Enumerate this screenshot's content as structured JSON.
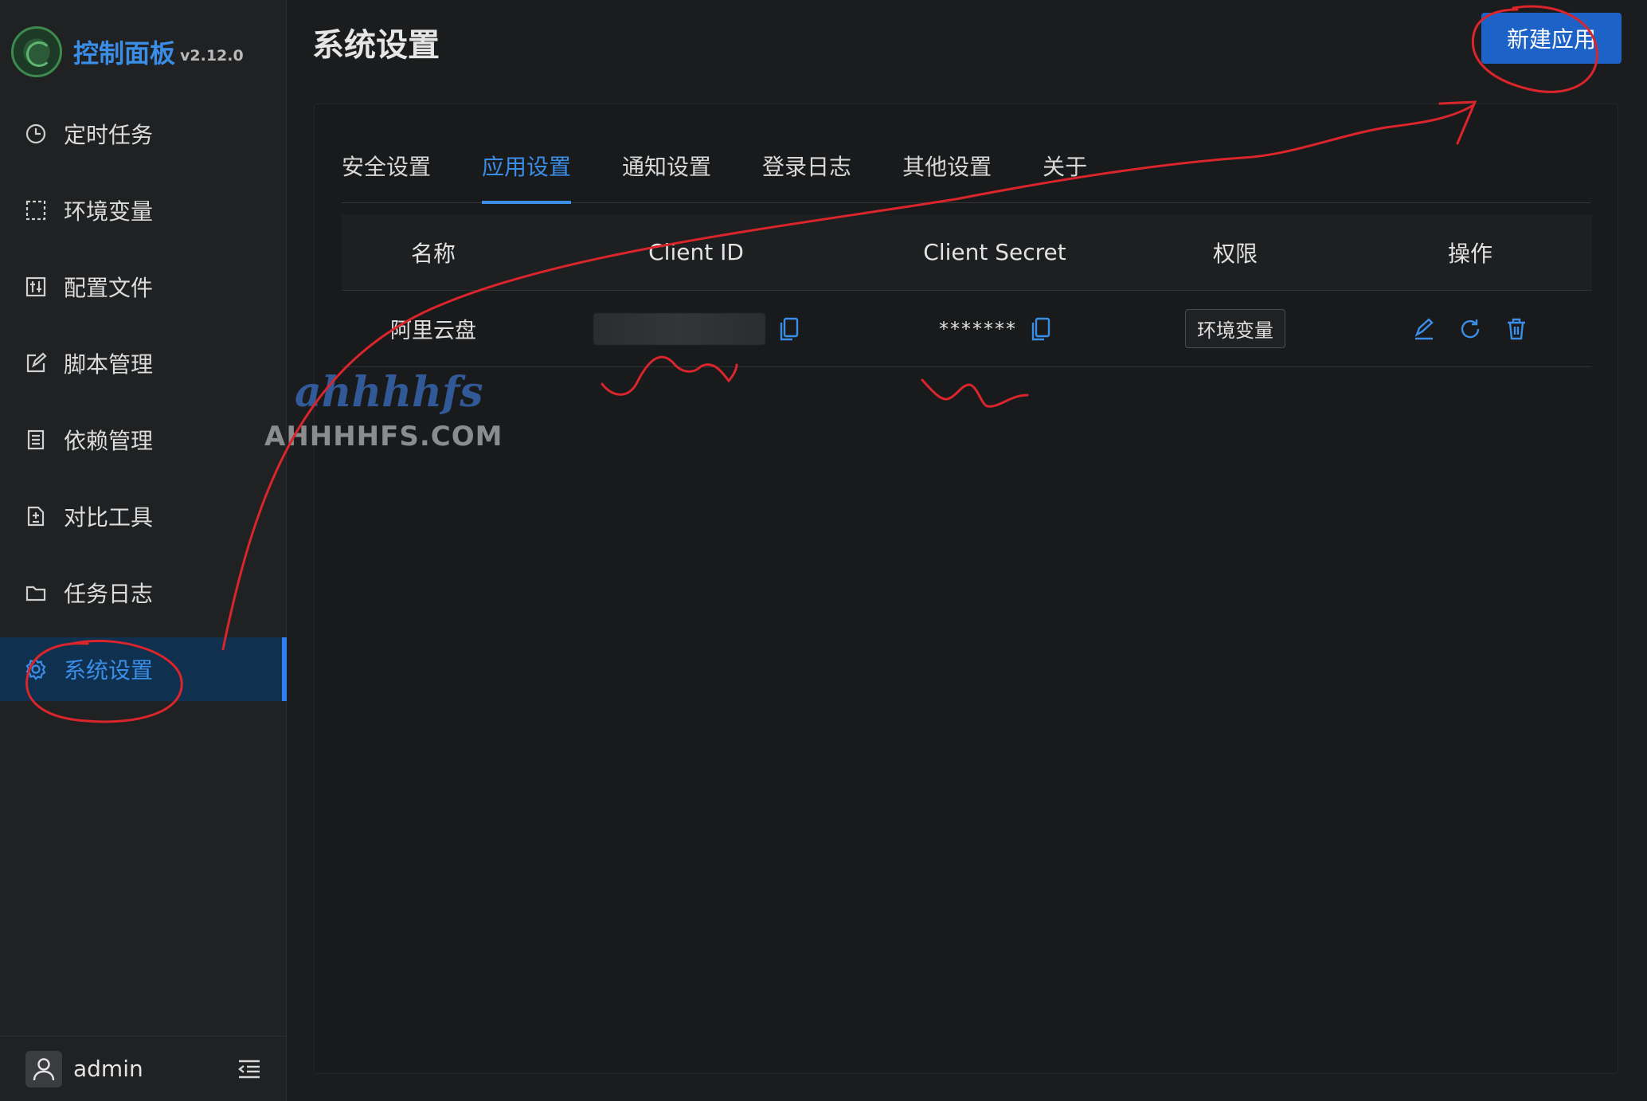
{
  "brand": {
    "title": "控制面板",
    "version": "v2.12.0"
  },
  "sidebar": {
    "items": [
      {
        "label": "定时任务",
        "icon": "clock-icon"
      },
      {
        "label": "环境变量",
        "icon": "dashed-box-icon"
      },
      {
        "label": "配置文件",
        "icon": "sliders-icon"
      },
      {
        "label": "脚本管理",
        "icon": "edit-icon"
      },
      {
        "label": "依赖管理",
        "icon": "document-icon"
      },
      {
        "label": "对比工具",
        "icon": "diff-icon"
      },
      {
        "label": "任务日志",
        "icon": "folder-icon"
      },
      {
        "label": "系统设置",
        "icon": "gear-icon",
        "active": true
      }
    ],
    "user": "admin"
  },
  "header": {
    "title": "系统设置",
    "new_app_label": "新建应用"
  },
  "tabs": [
    "安全设置",
    "应用设置",
    "通知设置",
    "登录日志",
    "其他设置",
    "关于"
  ],
  "active_tab": "应用设置",
  "table": {
    "headers": [
      "名称",
      "Client ID",
      "Client Secret",
      "权限",
      "操作"
    ],
    "rows": [
      {
        "name": "阿里云盘",
        "client_id": "",
        "client_secret": "*******",
        "scope": "环境变量"
      }
    ]
  },
  "watermark": {
    "script": "ahhhhfs",
    "text": "AHHHHFS.COM"
  },
  "colors": {
    "accent": "#3b8ee8",
    "button": "#1d63c7",
    "annotation": "#d9252b"
  }
}
